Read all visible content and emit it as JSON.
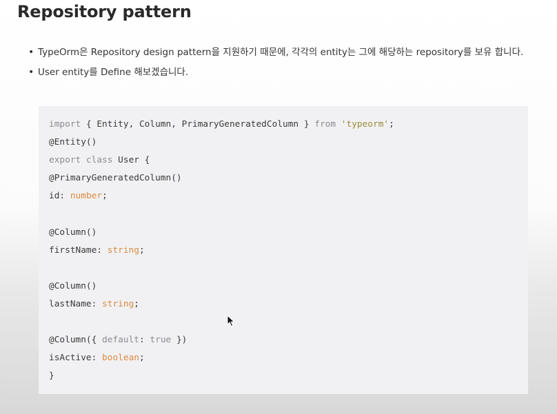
{
  "page": {
    "title": "Repository pattern"
  },
  "bullets": [
    {
      "text": "TypeOrm은 Repository design pattern을 지원하기 때문에, 각각의 entity는 그에 해당하는 repository를 보유 합니다."
    },
    {
      "text": "User entity를 Define 해보겠습니다."
    }
  ],
  "code": {
    "lines": [
      [
        {
          "t": "import",
          "c": "kw"
        },
        {
          "t": " { Entity, Column, PrimaryGeneratedColumn } ",
          "c": "plain"
        },
        {
          "t": "from",
          "c": "kw"
        },
        {
          "t": " ",
          "c": "plain"
        },
        {
          "t": "'typeorm'",
          "c": "str"
        },
        {
          "t": ";",
          "c": "plain"
        }
      ],
      [
        {
          "t": "@Entity()",
          "c": "plain"
        }
      ],
      [
        {
          "t": "export class",
          "c": "kw"
        },
        {
          "t": " User {",
          "c": "plain"
        }
      ],
      [
        {
          "t": "@PrimaryGeneratedColumn()",
          "c": "plain"
        }
      ],
      [
        {
          "t": "id: ",
          "c": "plain"
        },
        {
          "t": "number",
          "c": "type"
        },
        {
          "t": ";",
          "c": "plain"
        }
      ],
      [
        {
          "t": "",
          "c": "plain"
        }
      ],
      [
        {
          "t": "@Column()",
          "c": "plain"
        }
      ],
      [
        {
          "t": "firstName: ",
          "c": "plain"
        },
        {
          "t": "string",
          "c": "type"
        },
        {
          "t": ";",
          "c": "plain"
        }
      ],
      [
        {
          "t": "",
          "c": "plain"
        }
      ],
      [
        {
          "t": "@Column()",
          "c": "plain"
        }
      ],
      [
        {
          "t": "lastName: ",
          "c": "plain"
        },
        {
          "t": "string",
          "c": "type"
        },
        {
          "t": ";",
          "c": "plain"
        }
      ],
      [
        {
          "t": "",
          "c": "plain"
        }
      ],
      [
        {
          "t": "@Column({ ",
          "c": "plain"
        },
        {
          "t": "default",
          "c": "kw"
        },
        {
          "t": ": ",
          "c": "plain"
        },
        {
          "t": "true",
          "c": "kw"
        },
        {
          "t": " })",
          "c": "plain"
        }
      ],
      [
        {
          "t": "isActive: ",
          "c": "plain"
        },
        {
          "t": "boolean",
          "c": "type"
        },
        {
          "t": ";",
          "c": "plain"
        }
      ],
      [
        {
          "t": "}",
          "c": "plain"
        }
      ]
    ]
  },
  "icons": {
    "cursor": "mouse-pointer-icon"
  }
}
